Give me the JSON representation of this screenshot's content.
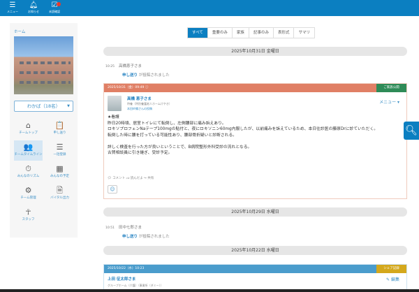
{
  "topbar": {
    "menu": "メニュー",
    "notice": "お知らせ",
    "unread": "未読確認"
  },
  "sidebar": {
    "home": "ホーム",
    "unit_select": "わかば（18名）",
    "items": [
      {
        "label": "チームトップ",
        "icon": "⌂"
      },
      {
        "label": "申し送り",
        "icon": "📋"
      },
      {
        "label": "チームタイムライン",
        "icon": "👥"
      },
      {
        "label": "一括登録",
        "icon": "☰"
      },
      {
        "label": "みんなのリズム",
        "icon": "⏱"
      },
      {
        "label": "みんなの予定",
        "icon": "▦"
      },
      {
        "label": "チーム管理",
        "icon": "⚙"
      },
      {
        "label": "バイタル出力",
        "icon": "🗎"
      },
      {
        "label": "スタッフ",
        "icon": "☥"
      }
    ]
  },
  "tabs": [
    "すべて",
    "重要のみ",
    "家族",
    "記事のみ",
    "表形式",
    "サマリ"
  ],
  "timeline": {
    "date1": "2025年10月31日 金曜日",
    "entry1": {
      "time": "10:25",
      "name": "高橋恵子さま",
      "link": "申し送り",
      "text": "が投稿されました"
    },
    "card1": {
      "header": "2025/10/31（金）09:49",
      "badge": "ご家族公開",
      "name": "高橋 恵子さま",
      "facility": "特養（特別養護老人ホームけやき）",
      "poster": "本田紗織さんの投稿",
      "menu": "メニュー ▾",
      "lines": [
        "★看護",
        "昨日20時頃、居室トイレにて転倒し、左側腰部に痛み訴えあり。",
        "ロキソプロフェンNaテープ100mgの貼付と、夜にロキソニン60mg内服したが、以前痛みを訴えているため、本日往診医の藤原Drに診ていただく。",
        "転倒した時に腰を打っている可能性あり、腰部骨折疑いと診断される。",
        "",
        "詳しく検査を行った方が良いということで、B病院整形外科受診の流れとなる。",
        "古賀相談員に引き継ぎ、受診予定。"
      ],
      "comment": "コメント",
      "like": "読んだよ",
      "share": "共有"
    },
    "date2": "2025年10月29日 水曜日",
    "entry2": {
      "time": "10:51",
      "name": "田中七郎さま",
      "link": "申し送り",
      "text": "が投稿されました"
    },
    "date3": "2025年10月22日 水曜日",
    "card2": {
      "header": "2025/10/22（水）10:23",
      "badge": "シェア記録",
      "name": "上田 征太郎さま",
      "facility": "グループホーム（介護）（事業所（ダミー））",
      "edit": "編集"
    }
  },
  "colors": {
    "brand": "#0b7fc1",
    "card1_header": "#e07f65",
    "family_badge": "#2e8b57",
    "card2_header": "#4a9ccc",
    "share_badge": "#d4a81c"
  }
}
